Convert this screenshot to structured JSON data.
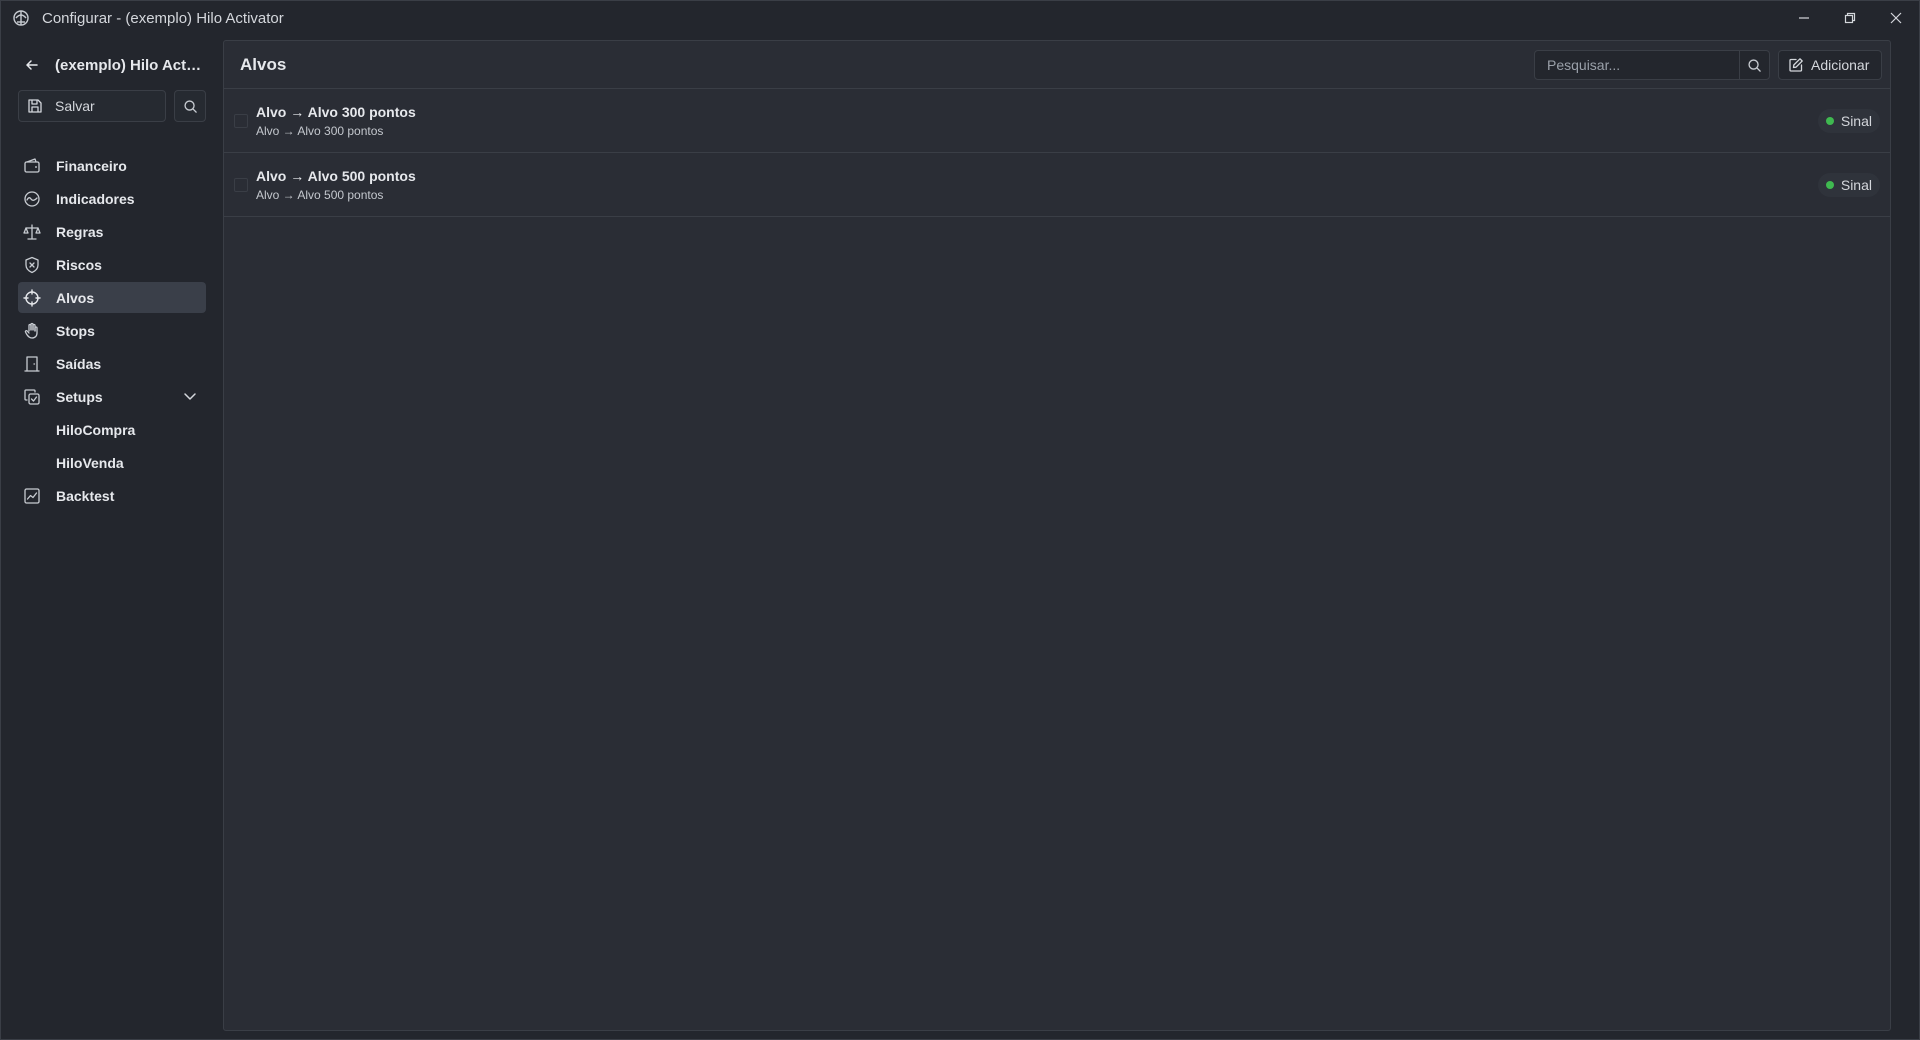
{
  "window": {
    "title": "Configurar - (exemplo) Hilo Activator"
  },
  "sidebar": {
    "back_label": "(exemplo) Hilo Activ...",
    "save_label": "Salvar",
    "items": [
      {
        "label": "Financeiro",
        "icon": "wallet-icon"
      },
      {
        "label": "Indicadores",
        "icon": "activity-icon"
      },
      {
        "label": "Regras",
        "icon": "scale-icon"
      },
      {
        "label": "Riscos",
        "icon": "shield-x-icon"
      },
      {
        "label": "Alvos",
        "icon": "crosshair-icon",
        "active": true
      },
      {
        "label": "Stops",
        "icon": "hand-icon"
      },
      {
        "label": "Saídas",
        "icon": "door-icon"
      },
      {
        "label": "Setups",
        "icon": "copy-check-icon",
        "expanded": true
      },
      {
        "label": "HiloCompra",
        "sub": true
      },
      {
        "label": "HiloVenda",
        "sub": true
      },
      {
        "label": "Backtest",
        "icon": "chart-line-icon"
      }
    ]
  },
  "main": {
    "title": "Alvos",
    "search_placeholder": "Pesquisar...",
    "add_label": "Adicionar",
    "items": [
      {
        "title": "Alvo → Alvo 300 pontos",
        "subtitle": "Alvo → Alvo 300 pontos",
        "badge": "Sinal"
      },
      {
        "title": "Alvo → Alvo 500 pontos",
        "subtitle": "Alvo → Alvo 500 pontos",
        "badge": "Sinal"
      }
    ]
  },
  "colors": {
    "background": "#2a2d35",
    "sidebar": "#23262d",
    "active_item": "#3a3f49",
    "border": "#3a3e46",
    "badge_dot": "#3fb950"
  }
}
